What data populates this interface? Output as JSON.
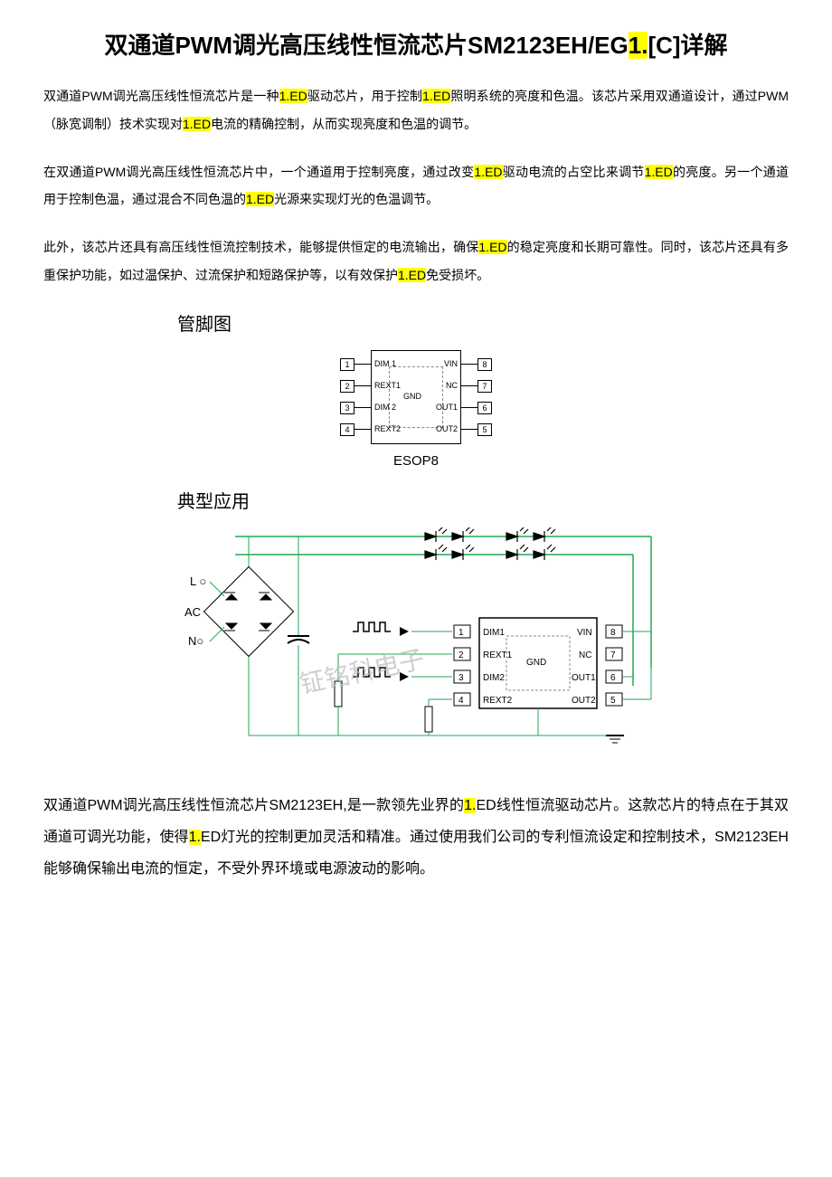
{
  "title": {
    "pre": "双通道PWM调光高压线性恒流芯片SM2123EH/EG",
    "hl": "1.",
    "post": "[C]详解"
  },
  "p1": {
    "t1": "双通道PWM调光高压线性恒流芯片是一种",
    "h1": "1.ED",
    "t2": "驱动芯片，用于控制",
    "h2": "1.ED",
    "t3": "照明系统的亮度和色温。该芯片采用双通道设计，通过PWM（脉宽调制）技术实现对",
    "h3": "1.ED",
    "t4": "电流的精确控制，从而实现亮度和色温的调节。"
  },
  "p2": {
    "t1": "在双通道PWM调光高压线性恒流芯片中，一个通道用于控制亮度，通过改变",
    "h1": "1.ED",
    "t2": "驱动电流的占空比来调节",
    "h2": "1.ED",
    "t3": "的亮度。另一个通道用于控制色温，通过混合不同色温的",
    "h3": "1.ED",
    "t4": "光源来实现灯光的色温调节。"
  },
  "p3": {
    "t1": "此外，该芯片还具有高压线性恒流控制技术，能够提供恒定的电流输出，确保",
    "h1": "1.ED",
    "t2": "的稳定亮度和长期可靠性。同时，该芯片还具有多重保护功能，如过温保护、过流保护和短路保护等，以有效保护",
    "h2": "1.ED",
    "t3": "免受损坏。"
  },
  "section1": "管脚图",
  "section2": "典型应用",
  "esop": "ESOP8",
  "pins": {
    "left": [
      {
        "n": "1",
        "label": "DIM 1"
      },
      {
        "n": "2",
        "label": "REXT1"
      },
      {
        "n": "3",
        "label": "DIM 2"
      },
      {
        "n": "4",
        "label": "REXT2"
      }
    ],
    "right": [
      {
        "n": "8",
        "label": "VIN"
      },
      {
        "n": "7",
        "label": "NC"
      },
      {
        "n": "6",
        "label": "OUT1"
      },
      {
        "n": "5",
        "label": "OUT2"
      }
    ],
    "gnd": "GND"
  },
  "circuit": {
    "ac_l": "L ○",
    "ac": "AC",
    "ac_n": "N○",
    "pins_left": [
      "DIM1",
      "REXT1",
      "DIM2",
      "REXT2"
    ],
    "pins_right": [
      "VIN",
      "NC",
      "OUT1",
      "OUT2"
    ],
    "nums_left": [
      "1",
      "2",
      "3",
      "4"
    ],
    "nums_right": [
      "8",
      "7",
      "6",
      "5"
    ],
    "gnd": "GND",
    "watermark": "钲铭科电子"
  },
  "p4": {
    "t1": "双通道PWM调光高压线性恒流芯片SM2123EH,是一款领先业界的",
    "h1": "1.",
    "t2": "ED线性恒流驱动芯片。这款芯片的特点在于其双通道可调光功能，使得",
    "h2": "1.",
    "t3": "ED灯光的控制更加灵活和精准。通过使用我们公司的专利恒流设定和控制技术，SM2123EH能够确保输出电流的恒定，不受外界环境或电源波动的影响。"
  }
}
